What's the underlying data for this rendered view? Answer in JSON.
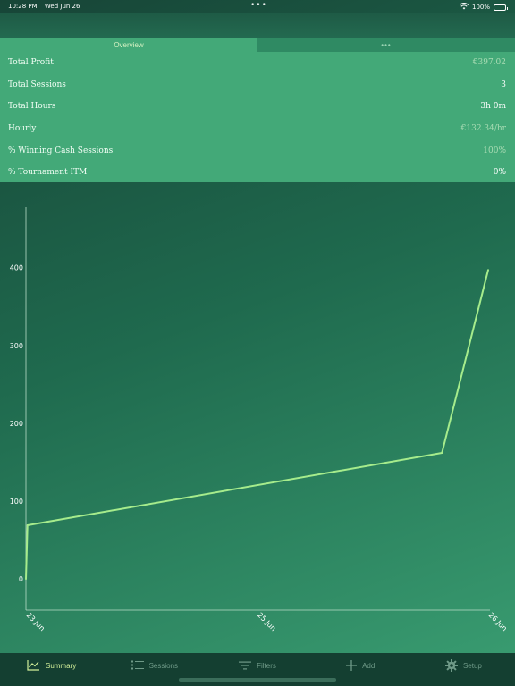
{
  "status_bar": {
    "time": "10:28 PM",
    "date": "Wed Jun 26",
    "dots": "•••",
    "battery": "100%",
    "wifi_icon": "wifi-icon",
    "battery_icon": "battery-icon"
  },
  "tabs": [
    {
      "label": "Overview",
      "active": true
    },
    {
      "label": "•••",
      "active": false
    }
  ],
  "stats": [
    {
      "label": "Total Profit",
      "value": "€397.02",
      "muted": true
    },
    {
      "label": "Total Sessions",
      "value": "3",
      "muted": false
    },
    {
      "label": "Total Hours",
      "value": "3h 0m",
      "muted": false
    },
    {
      "label": "Hourly",
      "value": "€132.34/hr",
      "muted": true
    },
    {
      "label": "% Winning Cash Sessions",
      "value": "100%",
      "muted": true
    },
    {
      "label": "% Tournament ITM",
      "value": "0%",
      "muted": false
    }
  ],
  "chart_data": {
    "type": "line",
    "x": [
      "23 Jun",
      "23 Jun",
      "25 Jun",
      "26 Jun"
    ],
    "x_days": [
      23.0,
      23.01,
      25.7,
      26.0
    ],
    "values": [
      0,
      69,
      162,
      397
    ],
    "ylim": [
      -40,
      480
    ],
    "yticks": [
      0,
      100,
      200,
      300,
      400
    ],
    "xticks": [
      "23 Jun",
      "25 Jun",
      "26 Jun"
    ],
    "xtick_days": [
      23.0,
      24.5,
      26.0
    ],
    "grid": false,
    "line_color": "#a6ec8c"
  },
  "tab_bar": [
    {
      "label": "Summary",
      "icon": "chart-icon",
      "active": true
    },
    {
      "label": "Sessions",
      "icon": "list-icon",
      "active": false
    },
    {
      "label": "Filters",
      "icon": "filter-icon",
      "active": false
    },
    {
      "label": "Add",
      "icon": "plus-icon",
      "active": false
    },
    {
      "label": "Setup",
      "icon": "gear-icon",
      "active": false
    }
  ]
}
